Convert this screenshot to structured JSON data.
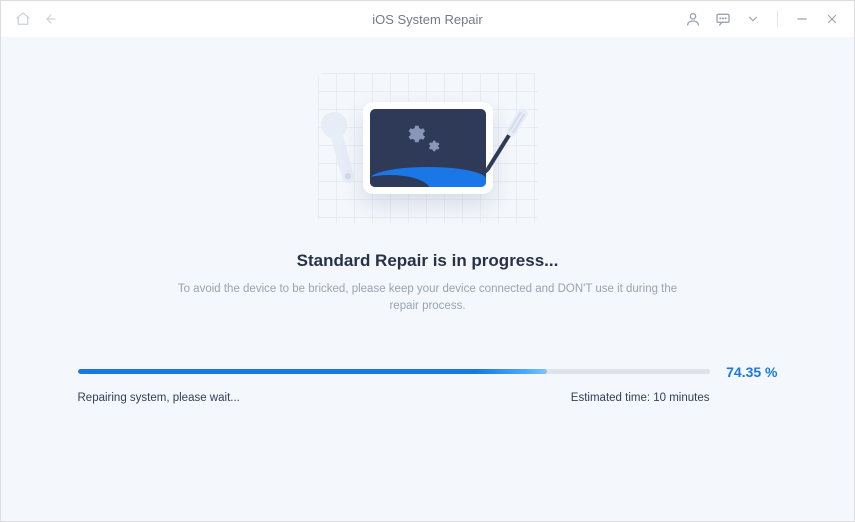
{
  "titlebar": {
    "title": "iOS System Repair"
  },
  "main": {
    "heading": "Standard Repair is in progress...",
    "subtext": "To avoid the device to be bricked, please keep your device connected and DON'T use it during the repair process."
  },
  "progress": {
    "percent_label": "74.35 %",
    "percent_value": 74.35,
    "fill_width": "74.35%",
    "status_text": "Repairing system, please wait...",
    "estimated_time": "Estimated time: 10 minutes"
  }
}
